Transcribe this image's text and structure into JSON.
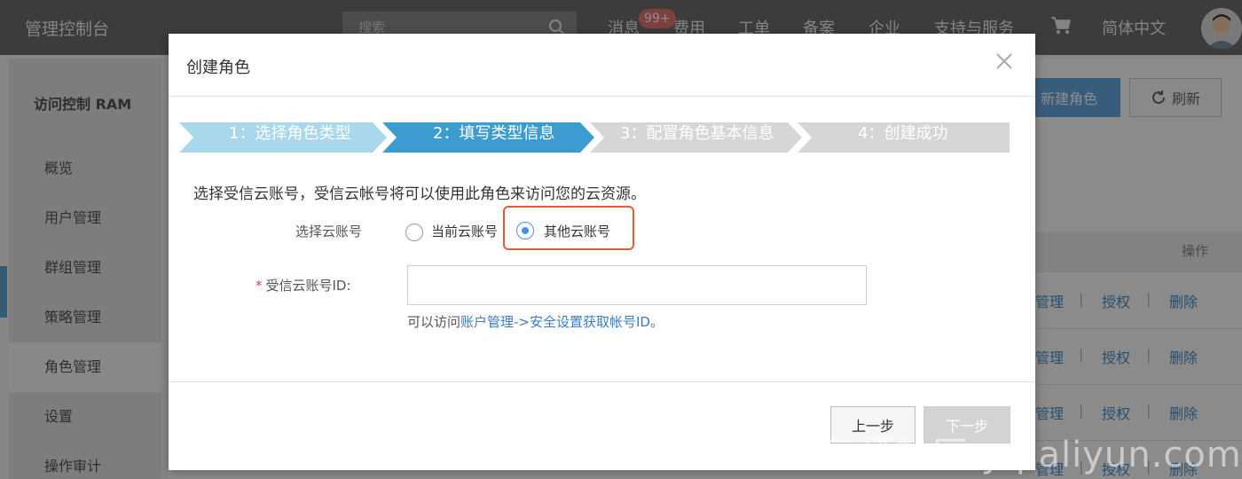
{
  "topbar": {
    "brand": "管理控制台",
    "search_placeholder": "搜索",
    "nav": [
      "消息",
      "费用",
      "工单",
      "备案",
      "企业",
      "支持与服务"
    ],
    "message_badge": "99+",
    "language": "简体中文"
  },
  "sidebar": {
    "title": "访问控制 RAM",
    "items": [
      {
        "label": "概览"
      },
      {
        "label": "用户管理"
      },
      {
        "label": "群组管理"
      },
      {
        "label": "策略管理"
      },
      {
        "label": "角色管理"
      },
      {
        "label": "设置"
      },
      {
        "label": "操作审计"
      }
    ],
    "active_index": 4
  },
  "background_page": {
    "new_role_label": "新建角色",
    "refresh_label": "刷新",
    "table_header_actions": "操作",
    "row_actions": {
      "manage": "管理",
      "authorize": "授权",
      "delete": "删除"
    }
  },
  "modal": {
    "title": "创建角色",
    "steps": [
      {
        "label": "1：选择角色类型",
        "status": "done"
      },
      {
        "label": "2：填写类型信息",
        "status": "active"
      },
      {
        "label": "3：配置角色基本信息",
        "status": "todo"
      },
      {
        "label": "4：创建成功",
        "status": "todo"
      }
    ],
    "intro": "选择受信云账号，受信云帐号将可以使用此角色来访问您的云资源。",
    "account_label": "选择云账号",
    "radio_options": [
      {
        "label": "当前云账号",
        "checked": false
      },
      {
        "label": "其他云账号",
        "checked": true
      }
    ],
    "id_label": "受信云账号ID:",
    "id_value": "",
    "hint_prefix": "可以访问",
    "hint_link": "账户管理->安全设置获取帐号ID。",
    "prev_label": "上一步",
    "next_label": "下一步"
  },
  "watermark": "云栖社区 yq.aliyun.com",
  "colors": {
    "step_done": "#a9d8ec",
    "step_active": "#3d9ccf",
    "step_todo": "#d6d6d6",
    "primary_blue": "#66a8e0",
    "highlight_border": "#e85a33",
    "link": "#3a7cc4"
  }
}
